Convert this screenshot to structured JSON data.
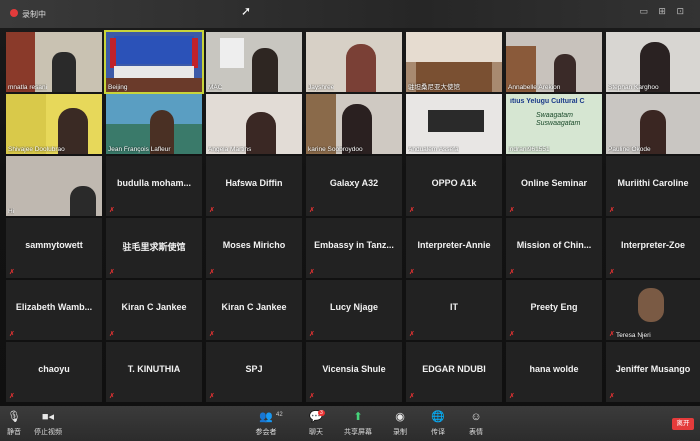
{
  "topbar": {
    "record_label": "录制中",
    "window_icons": "▭ ⊞ ⊡"
  },
  "row1": [
    {
      "label": "mnatla resani"
    },
    {
      "label": "Beijing"
    },
    {
      "label": "MAC"
    },
    {
      "label": "Jayshree"
    },
    {
      "label": "驻坦桑尼亚大使馆"
    },
    {
      "label": "Annabelle Arekion"
    },
    {
      "label": "Stephan Karghoo"
    }
  ],
  "row2": [
    {
      "label": "Shivajee Doolubrao"
    },
    {
      "label": "Jean François Lafleur"
    },
    {
      "label": "Angela Martins"
    },
    {
      "label": "karine Soobroydoo"
    },
    {
      "label": "Andualem Assefa"
    },
    {
      "label": "Indrani961551",
      "banner": "itius Yelugu Cultural C",
      "banner_sub": "Swaagatam Suswaagatam"
    },
    {
      "label": "Pauline Okode"
    }
  ],
  "row3_first": {
    "label": "Hi"
  },
  "row3_names": [
    "budulla moham...",
    "Hafswa Diffin",
    "Galaxy A32",
    "OPPO A1k",
    "Online Seminar",
    "Muriithi Caroline"
  ],
  "row4_names": [
    "sammytowett",
    "驻毛里求斯使馆",
    "Moses Miricho",
    "Embassy in Tanz...",
    "Interpreter-Annie",
    "Mission of Chin...",
    "Interpreter-Zoe"
  ],
  "row5_names": [
    "Elizabeth Wamb...",
    "Kiran C Jankee",
    "Kiran C Jankee",
    "Lucy Njage",
    "IT",
    "Preety Eng"
  ],
  "row5_last": {
    "label": "Teresa Njeri"
  },
  "row6_names": [
    "chaoyu",
    "T. KINUTHIA",
    "SPJ",
    "Vicensia Shule",
    "EDGAR NDUBI",
    "hana wolde",
    "Jeniffer Musango"
  ],
  "toolbar": {
    "mute": "静音",
    "stop_video": "停止视频",
    "participants": "参会者",
    "participants_count": "42",
    "chat": "聊天",
    "chat_badge": "3",
    "share": "共享屏幕",
    "record": "录制",
    "translate": "传译",
    "reactions": "表情",
    "end": "离开"
  }
}
